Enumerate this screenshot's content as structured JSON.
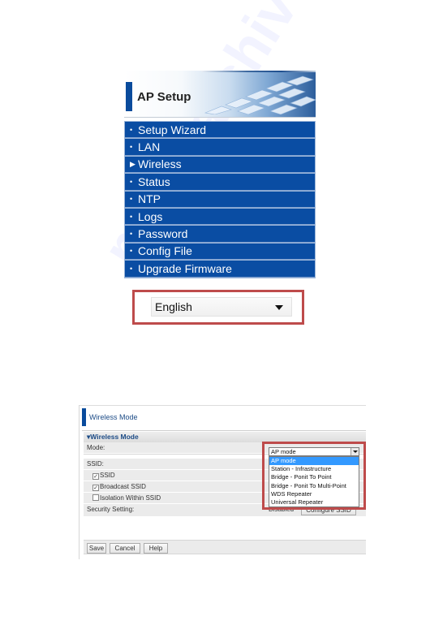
{
  "ap_setup": {
    "title": "AP Setup",
    "menu": [
      {
        "label": "Setup Wizard",
        "icon": "bullet",
        "active": false
      },
      {
        "label": "LAN",
        "icon": "bullet",
        "active": false
      },
      {
        "label": "Wireless",
        "icon": "arrow-right",
        "active": true
      },
      {
        "label": "Status",
        "icon": "bullet",
        "active": false
      },
      {
        "label": "NTP",
        "icon": "bullet",
        "active": false
      },
      {
        "label": "Logs",
        "icon": "bullet",
        "active": false
      },
      {
        "label": "Password",
        "icon": "bullet",
        "active": false
      },
      {
        "label": "Config File",
        "icon": "bullet",
        "active": false
      },
      {
        "label": "Upgrade Firmware",
        "icon": "bullet",
        "active": false
      }
    ],
    "language": {
      "selected": "English"
    }
  },
  "wireless_mode": {
    "page_title": "Wireless Mode",
    "section_title": "Wireless Mode",
    "mode_label": "Mode:",
    "mode_selected": "AP mode",
    "mode_options": [
      "AP mode",
      "Station - Infrastructure",
      "Bridge - Ponit To Point",
      "Bridge - Ponit To Multi-Point",
      "WDS Repeater",
      "Universal Repeater"
    ],
    "ssid_label": "SSID:",
    "ssid_checkbox": {
      "label": "SSID",
      "checked": true
    },
    "broadcast_ssid": {
      "label": "Broadcast SSID",
      "checked": true
    },
    "isolation": {
      "label": "Isolation Within SSID",
      "checked": false
    },
    "security_label": "Security Setting:",
    "security_value": "Disabled",
    "configure_ssid": "Configure SSID",
    "buttons": {
      "save": "Save",
      "cancel": "Cancel",
      "help": "Help"
    }
  },
  "symbols": {
    "bullet": "•",
    "arrow": "▶",
    "check": "✓"
  },
  "colors": {
    "menu_blue": "#0a4da3",
    "highlight_red": "#be4b4b",
    "selected_option": "#3399ff"
  },
  "watermark": "manualshive.com"
}
